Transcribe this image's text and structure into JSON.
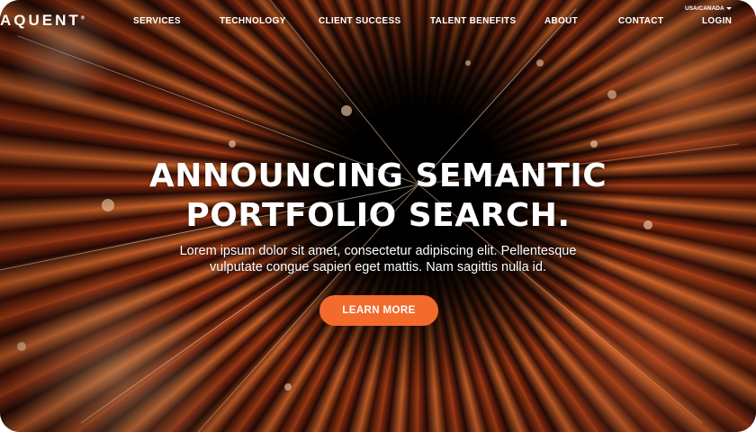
{
  "header": {
    "logo_text": "AQUENT",
    "logo_mark": "®",
    "region_label": "USA/CANADA",
    "nav": [
      {
        "label": "SERVICES"
      },
      {
        "label": "TECHNOLOGY"
      },
      {
        "label": "CLIENT SUCCESS"
      },
      {
        "label": "TALENT BENEFITS"
      },
      {
        "label": "ABOUT"
      },
      {
        "label": "CONTACT"
      },
      {
        "label": "LOGIN"
      }
    ]
  },
  "hero": {
    "headline_line1": "ANNOUNCING SEMANTIC",
    "headline_line2": "PORTFOLIO SEARCH.",
    "subtext_line1": "Lorem ipsum dolor sit amet, consectetur adipiscing elit. Pellentesque",
    "subtext_line2": "vulputate congue sapien eget mattis. Nam sagittis nulla id.",
    "cta_label": "LEARN MORE",
    "colors": {
      "accent": "#f26b2d",
      "background": "#0a0604",
      "text": "#ffffff"
    }
  },
  "icons": {
    "region_caret": "chevron-down-icon"
  }
}
